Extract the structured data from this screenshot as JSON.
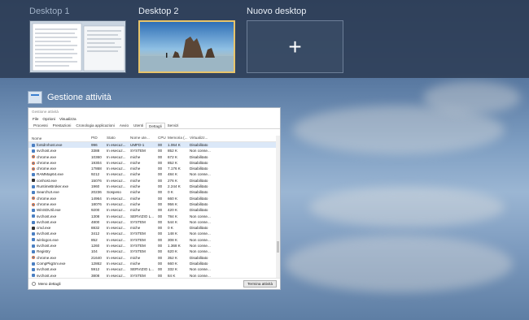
{
  "desktops": {
    "items": [
      {
        "label": "Desktop 1"
      },
      {
        "label": "Desktop 2"
      },
      {
        "label": "Nuovo desktop"
      }
    ],
    "add_symbol": "+"
  },
  "taskmanager": {
    "title": "Gestione attività",
    "window_title": "Gestione attività",
    "menu": [
      "File",
      "Opzioni",
      "Visualizza"
    ],
    "tabs": [
      "Processi",
      "Prestazioni",
      "Cronologia applicazioni",
      "Avvio",
      "Utenti",
      "Dettagli",
      "Servizi"
    ],
    "active_tab": "Dettagli",
    "columns": [
      "Nome",
      "PID",
      "Stato",
      "Nome ute...",
      "CPU",
      "Memoria (...",
      "Virtualizz..."
    ],
    "rows": [
      {
        "icon": "app",
        "name": "fontdrvhost.exe",
        "pid": "996",
        "stato": "In esecuz...",
        "user": "UMFD-1",
        "cpu": "00",
        "mem": "1.064 K",
        "virt": "Disabilitato"
      },
      {
        "icon": "app",
        "name": "svchost.exe",
        "pid": "3388",
        "stato": "In esecuz...",
        "user": "SYSTEM",
        "cpu": "00",
        "mem": "852 K",
        "virt": "Non conse..."
      },
      {
        "icon": "chrome",
        "name": "chrome.exe",
        "pid": "10360",
        "stato": "In esecuz...",
        "user": "miche",
        "cpu": "00",
        "mem": "672 K",
        "virt": "Disabilitato"
      },
      {
        "icon": "chrome",
        "name": "chrome.exe",
        "pid": "19304",
        "stato": "In esecuz...",
        "user": "miche",
        "cpu": "00",
        "mem": "852 K",
        "virt": "Disabilitato"
      },
      {
        "icon": "chrome",
        "name": "chrome.exe",
        "pid": "17868",
        "stato": "In esecuz...",
        "user": "miche",
        "cpu": "00",
        "mem": "7.176 K",
        "virt": "Disabilitato"
      },
      {
        "icon": "app",
        "name": "RAMMap64.exe",
        "pid": "9212",
        "stato": "In esecuz...",
        "user": "miche",
        "cpu": "00",
        "mem": "484 K",
        "virt": "Non conse..."
      },
      {
        "icon": "dark",
        "name": "conhost.exe",
        "pid": "15076",
        "stato": "In esecuz...",
        "user": "miche",
        "cpu": "00",
        "mem": "276 K",
        "virt": "Disabilitato"
      },
      {
        "icon": "app",
        "name": "RuntimeBroker.exe",
        "pid": "1960",
        "stato": "In esecuz...",
        "user": "miche",
        "cpu": "00",
        "mem": "2.244 K",
        "virt": "Disabilitato"
      },
      {
        "icon": "app",
        "name": "SearchUI.exe",
        "pid": "20236",
        "stato": "Sospeso",
        "user": "miche",
        "cpu": "00",
        "mem": "0 K",
        "virt": "Disabilitato"
      },
      {
        "icon": "chrome",
        "name": "chrome.exe",
        "pid": "14964",
        "stato": "In esecuz...",
        "user": "miche",
        "cpu": "00",
        "mem": "660 K",
        "virt": "Disabilitato"
      },
      {
        "icon": "chrome",
        "name": "chrome.exe",
        "pid": "18076",
        "stato": "In esecuz...",
        "user": "miche",
        "cpu": "00",
        "mem": "956 K",
        "virt": "Disabilitato"
      },
      {
        "icon": "app",
        "name": "WinSDUtil.exe",
        "pid": "9200",
        "stato": "In esecuz...",
        "user": "miche",
        "cpu": "00",
        "mem": "420 K",
        "virt": "Disabilitato"
      },
      {
        "icon": "app",
        "name": "svchost.exe",
        "pid": "1308",
        "stato": "In esecuz...",
        "user": "SERVIZIO L...",
        "cpu": "00",
        "mem": "784 K",
        "virt": "Non conse..."
      },
      {
        "icon": "app",
        "name": "svchost.exe",
        "pid": "4800",
        "stato": "In esecuz...",
        "user": "SYSTEM",
        "cpu": "00",
        "mem": "544 K",
        "virt": "Non conse..."
      },
      {
        "icon": "dark",
        "name": "cmd.exe",
        "pid": "8832",
        "stato": "In esecuz...",
        "user": "miche",
        "cpu": "00",
        "mem": "0 K",
        "virt": "Disabilitato"
      },
      {
        "icon": "app",
        "name": "svchost.exe",
        "pid": "3412",
        "stato": "In esecuz...",
        "user": "SYSTEM",
        "cpu": "00",
        "mem": "148 K",
        "virt": "Non conse..."
      },
      {
        "icon": "app",
        "name": "winlogon.exe",
        "pid": "852",
        "stato": "In esecuz...",
        "user": "SYSTEM",
        "cpu": "00",
        "mem": "308 K",
        "virt": "Non conse..."
      },
      {
        "icon": "app",
        "name": "svchost.exe",
        "pid": "1260",
        "stato": "In esecuz...",
        "user": "SYSTEM",
        "cpu": "00",
        "mem": "1.368 K",
        "virt": "Non conse..."
      },
      {
        "icon": "app",
        "name": "Registry",
        "pid": "104",
        "stato": "In esecuz...",
        "user": "SYSTEM",
        "cpu": "00",
        "mem": "620 K",
        "virt": "Non conse..."
      },
      {
        "icon": "chrome",
        "name": "chrome.exe",
        "pid": "21640",
        "stato": "In esecuz...",
        "user": "miche",
        "cpu": "00",
        "mem": "352 K",
        "virt": "Disabilitato"
      },
      {
        "icon": "app",
        "name": "CompPkgSrv.exe",
        "pid": "12862",
        "stato": "In esecuz...",
        "user": "miche",
        "cpu": "00",
        "mem": "660 K",
        "virt": "Disabilitato"
      },
      {
        "icon": "app",
        "name": "svchost.exe",
        "pid": "5912",
        "stato": "In esecuz...",
        "user": "SERVIZIO L...",
        "cpu": "00",
        "mem": "332 K",
        "virt": "Non conse..."
      },
      {
        "icon": "app",
        "name": "svchost.exe",
        "pid": "3808",
        "stato": "In esecuz...",
        "user": "SYSTEM",
        "cpu": "00",
        "mem": "84 K",
        "virt": "Non conse..."
      }
    ],
    "less_details": "Meno dettagli",
    "end_task": "Termina attività"
  },
  "colors": {
    "strip": "#2e3e56",
    "selected_border": "#e8c46a",
    "selected_row": "#dbe8f8"
  }
}
